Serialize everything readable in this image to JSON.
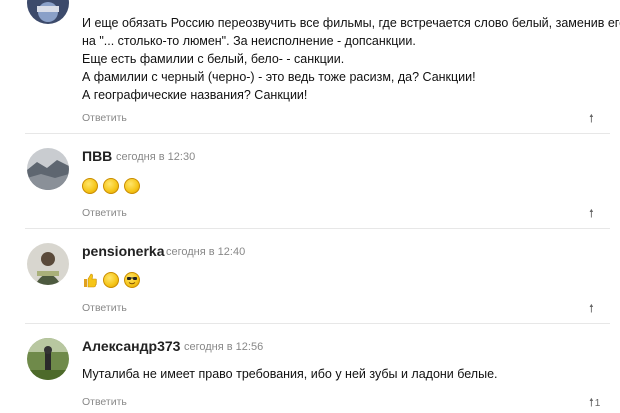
{
  "comments": [
    {
      "author": "",
      "time": "",
      "lines": [
        "И еще обязать Россию переозвучить все фильмы, где встречается слово белый, заменив его",
        "на \"... столько-то люмен\". За неисполнение - допсанкции.",
        "Еще есть фамилии с белый, бело- - санкции.",
        "А фамилии с черный (черно-) - это ведь тоже расизм, да? Санкции!",
        "А географические названия? Санкции!"
      ],
      "reply_label": "Ответить",
      "rating": ""
    },
    {
      "author": "ПВВ",
      "time": "сегодня в 12:30",
      "emojis": [
        "smile-emoji",
        "smile-emoji",
        "smile-emoji"
      ],
      "reply_label": "Ответить",
      "rating": ""
    },
    {
      "author": "pensionerka",
      "time": "сегодня в 12:40",
      "emojis": [
        "thumbs-up-emoji",
        "smile-emoji",
        "sunglasses-emoji"
      ],
      "reply_label": "Ответить",
      "rating": ""
    },
    {
      "author": "Александр373",
      "time": "сегодня в 12:56",
      "lines": [
        "Муталиба не имеет право требования, ибо у ней зубы и ладони белые."
      ],
      "reply_label": "Ответить",
      "rating": "1"
    }
  ],
  "icons": {
    "upvote": "up-arrow-icon"
  },
  "colors": {
    "text": "#111111",
    "muted": "#888888",
    "divider": "#e7e7e7",
    "emoji": "#f5c518"
  }
}
